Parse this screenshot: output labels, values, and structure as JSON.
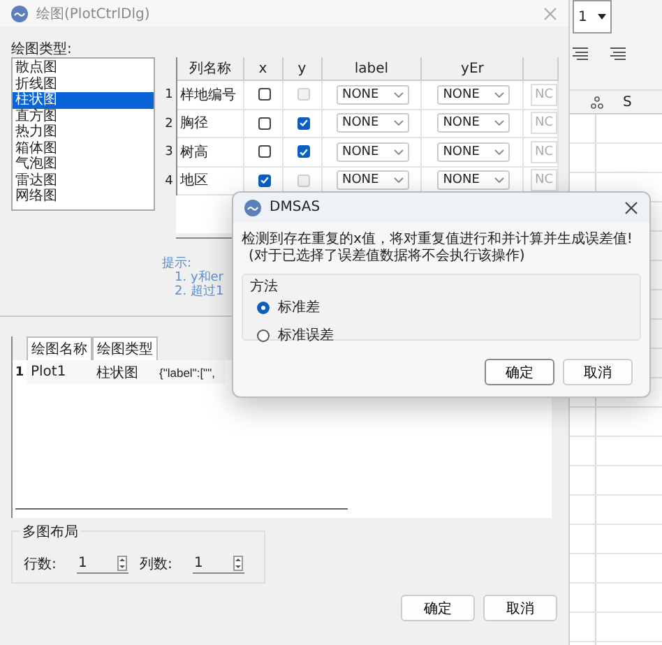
{
  "main_window": {
    "title": "绘图(PlotCtrlDlg)"
  },
  "plot_types_label": "绘图类型:",
  "plot_types": [
    {
      "label": "散点图",
      "selected": false
    },
    {
      "label": "折线图",
      "selected": false
    },
    {
      "label": "柱状图",
      "selected": true
    },
    {
      "label": "直方图",
      "selected": false
    },
    {
      "label": "热力图",
      "selected": false
    },
    {
      "label": "箱体图",
      "selected": false
    },
    {
      "label": "气泡图",
      "selected": false
    },
    {
      "label": "雷达图",
      "selected": false
    },
    {
      "label": "网络图",
      "selected": false
    }
  ],
  "columns_table": {
    "columns": [
      "列名称",
      "x",
      "y",
      "label",
      "yEr"
    ],
    "rows": [
      {
        "index": "1",
        "name": "样地编号",
        "x": false,
        "y": false,
        "y_disabled": true,
        "label": "NONE",
        "yer": "NONE",
        "column_6": "NC"
      },
      {
        "index": "2",
        "name": "胸径",
        "x": false,
        "y": true,
        "y_disabled": false,
        "label": "NONE",
        "yer": "NONE",
        "column_6": "NC"
      },
      {
        "index": "3",
        "name": "树高",
        "x": false,
        "y": true,
        "y_disabled": false,
        "label": "NONE",
        "yer": "NONE",
        "column_6": "NC"
      },
      {
        "index": "4",
        "name": "地区",
        "x": true,
        "y": false,
        "y_disabled": true,
        "label": "NONE",
        "yer": "NONE",
        "column_6": "NC"
      }
    ]
  },
  "hints": {
    "title": "提示:",
    "lines": [
      "1. y和er",
      "2. 超过1"
    ]
  },
  "plots_table": {
    "columns": [
      "绘图名称",
      "绘图类型"
    ],
    "rows": [
      {
        "index": "1",
        "name": "Plot1",
        "type": "柱状图",
        "settings": "{\"label\":[\"\","
      }
    ]
  },
  "layout_group": {
    "title": "多图布局",
    "rows_label": "行数:",
    "rows_value": "1",
    "cols_label": "列数:",
    "cols_value": "1"
  },
  "buttons": [
    "确定",
    "取消"
  ],
  "modal": {
    "title": "DMSAS",
    "message": [
      "检测到存在重复的x值，将对重复值进行和并计算并生成误差值!",
      "(对于已选择了误差值数据将不会执行该操作)"
    ],
    "method_label": "方法",
    "options": [
      {
        "label": "标准差",
        "selected": true
      },
      {
        "label": "标准误差",
        "selected": false
      }
    ],
    "buttons": [
      "确定",
      "取消"
    ]
  },
  "background_sheet": {
    "dropdown_value": "1",
    "column_header": "S"
  }
}
